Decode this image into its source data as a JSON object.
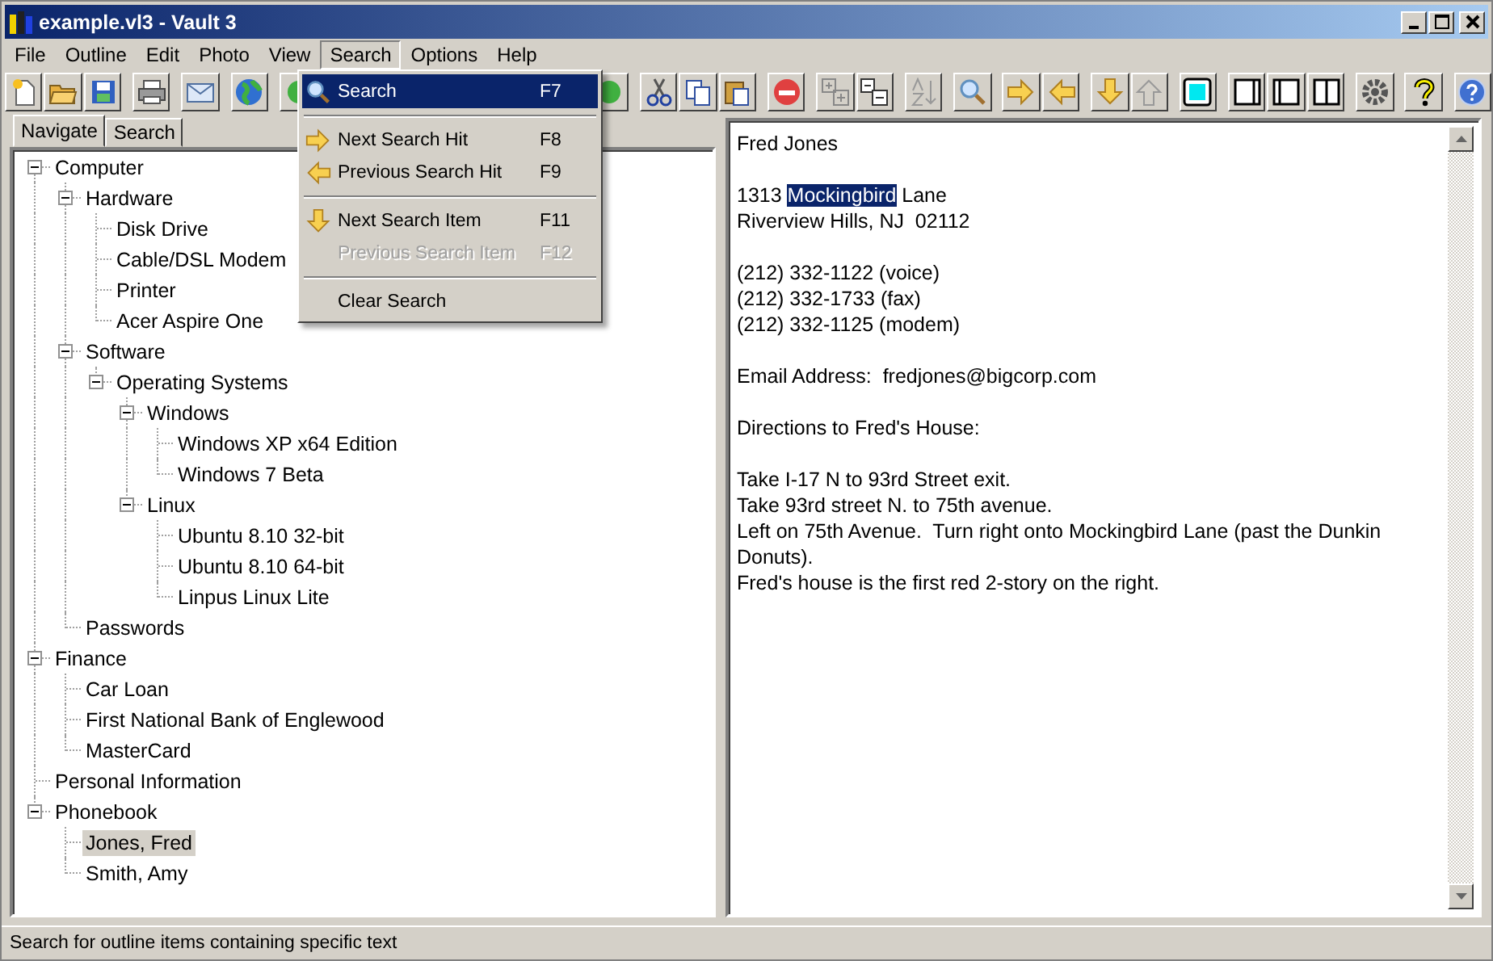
{
  "window": {
    "title": "example.vl3 - Vault 3"
  },
  "menu_bar": [
    {
      "label": "File",
      "open": false
    },
    {
      "label": "Outline",
      "open": false
    },
    {
      "label": "Edit",
      "open": false
    },
    {
      "label": "Photo",
      "open": false
    },
    {
      "label": "View",
      "open": false
    },
    {
      "label": "Search",
      "open": true
    },
    {
      "label": "Options",
      "open": false
    },
    {
      "label": "Help",
      "open": false
    }
  ],
  "dropdown": {
    "items": [
      {
        "kind": "find",
        "label": "Search",
        "shortcut": "F7",
        "selected": true,
        "disabled": false
      },
      {
        "kind": "separator"
      },
      {
        "kind": "forward",
        "label": "Next Search Hit",
        "shortcut": "F8",
        "selected": false,
        "disabled": false
      },
      {
        "kind": "back",
        "label": "Previous Search Hit",
        "shortcut": "F9",
        "selected": false,
        "disabled": false
      },
      {
        "kind": "separator"
      },
      {
        "kind": "down",
        "label": "Next Search Item",
        "shortcut": "F11",
        "selected": false,
        "disabled": false
      },
      {
        "kind": "plain",
        "label": "Previous Search Item",
        "shortcut": "F12",
        "selected": false,
        "disabled": true
      },
      {
        "kind": "separator"
      },
      {
        "kind": "plain",
        "label": "Clear Search",
        "selected": false,
        "disabled": false
      }
    ]
  },
  "tabs": [
    {
      "label": "Navigate",
      "selected": true
    },
    {
      "label": "Search",
      "selected": false
    }
  ],
  "tree": [
    {
      "label": "Computer",
      "expanded": true,
      "selected": false,
      "children": [
        {
          "label": "Hardware",
          "expanded": true,
          "selected": false,
          "children": [
            {
              "label": "Disk Drive",
              "selected": false
            },
            {
              "label": "Cable/DSL Modem",
              "selected": false
            },
            {
              "label": "Printer",
              "selected": false
            },
            {
              "label": "Acer Aspire One",
              "selected": false
            }
          ]
        },
        {
          "label": "Software",
          "expanded": true,
          "selected": false,
          "children": [
            {
              "label": "Operating Systems",
              "expanded": true,
              "selected": false,
              "children": [
                {
                  "label": "Windows",
                  "expanded": true,
                  "selected": false,
                  "children": [
                    {
                      "label": "Windows XP x64 Edition",
                      "selected": false
                    },
                    {
                      "label": "Windows 7 Beta",
                      "selected": false
                    }
                  ]
                },
                {
                  "label": "Linux",
                  "expanded": true,
                  "selected": false,
                  "children": [
                    {
                      "label": "Ubuntu 8.10 32-bit",
                      "selected": false
                    },
                    {
                      "label": "Ubuntu 8.10 64-bit",
                      "selected": false
                    },
                    {
                      "label": "Linpus Linux Lite",
                      "selected": false
                    }
                  ]
                }
              ]
            }
          ]
        },
        {
          "label": "Passwords",
          "selected": false
        }
      ]
    },
    {
      "label": "Finance",
      "expanded": true,
      "selected": false,
      "children": [
        {
          "label": "Car Loan",
          "selected": false
        },
        {
          "label": "First National Bank of Englewood",
          "selected": false
        },
        {
          "label": "MasterCard",
          "selected": false
        }
      ]
    },
    {
      "label": "Personal Information",
      "selected": false
    },
    {
      "label": "Phonebook",
      "expanded": true,
      "selected": false,
      "children": [
        {
          "label": "Jones, Fred",
          "selected": true
        },
        {
          "label": "Smith, Amy",
          "selected": false
        }
      ]
    }
  ],
  "editor": {
    "paragraphs": [
      [
        [
          {
            "text": "Fred Jones",
            "selected": false
          }
        ]
      ],
      [
        [
          {
            "text": "1313 ",
            "selected": false
          },
          {
            "text": "Mockingbird",
            "selected": true
          },
          {
            "text": " Lane",
            "selected": false
          }
        ],
        [
          {
            "text": "Riverview Hills, NJ  02112",
            "selected": false
          }
        ]
      ],
      [
        [
          {
            "text": "(212) 332-1122 (voice)",
            "selected": false
          }
        ],
        [
          {
            "text": "(212) 332-1733 (fax)",
            "selected": false
          }
        ],
        [
          {
            "text": "(212) 332-1125 (modem)",
            "selected": false
          }
        ]
      ],
      [
        [
          {
            "text": "Email Address:  fredjones@bigcorp.com",
            "selected": false
          }
        ]
      ],
      [
        [
          {
            "text": "Directions to Fred's House:",
            "selected": false
          }
        ]
      ],
      [
        [
          {
            "text": "Take I-17 N to 93rd Street exit.",
            "selected": false
          }
        ],
        [
          {
            "text": "Take 93rd street N. to 75th avenue.",
            "selected": false
          }
        ],
        [
          {
            "text": "Left on 75th Avenue.  Turn right onto Mockingbird Lane (past the Dunkin",
            "selected": false
          }
        ],
        [
          {
            "text": "Donuts).",
            "selected": false
          }
        ],
        [
          {
            "text": "Fred's house is the first red 2-story on the right.",
            "selected": false
          }
        ]
      ]
    ]
  },
  "status_bar": "Search for outline items containing specific text"
}
